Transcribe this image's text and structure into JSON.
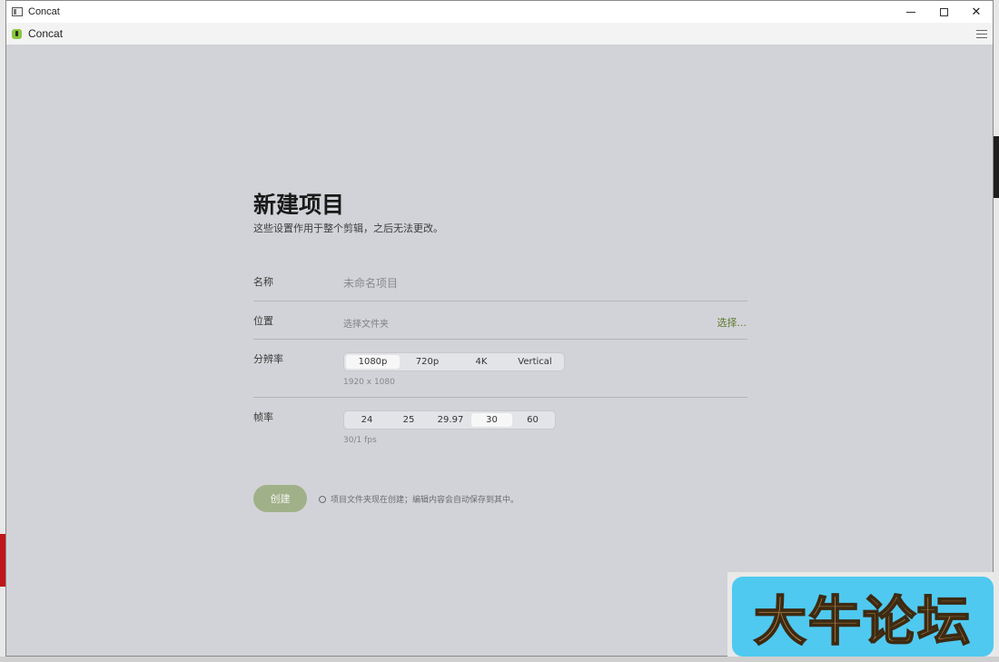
{
  "window": {
    "title": "Concat",
    "controls": {
      "minimize": "—",
      "maximize": "☐",
      "close": "✕"
    }
  },
  "appbar": {
    "name": "Concat",
    "logo_color": "#8cc63f",
    "settings_icon": "sliders-icon"
  },
  "page": {
    "heading": "新建项目",
    "subtitle": "这些设置作用于整个剪辑，之后无法更改。"
  },
  "fields": {
    "name": {
      "label": "名称",
      "placeholder": "未命名项目",
      "value": ""
    },
    "location": {
      "label": "位置",
      "value": "选择文件夹",
      "action": "选择..."
    },
    "resolution": {
      "label": "分辨率",
      "options": [
        "1080p",
        "720p",
        "4K",
        "Vertical"
      ],
      "selected": "1080p",
      "hint": "1920 x 1080"
    },
    "framerate": {
      "label": "帧率",
      "options": [
        "24",
        "25",
        "29.97",
        "30",
        "60"
      ],
      "selected": "30",
      "hint": "30/1 fps"
    }
  },
  "footer": {
    "create_label": "创建",
    "note": "项目文件夹现在创建；编辑内容会自动保存到其中。",
    "accent": "#a0b189"
  },
  "watermark": {
    "text": "大牛论坛",
    "bg_color": "#4fc9f0",
    "text_color": "#b98a4e"
  }
}
